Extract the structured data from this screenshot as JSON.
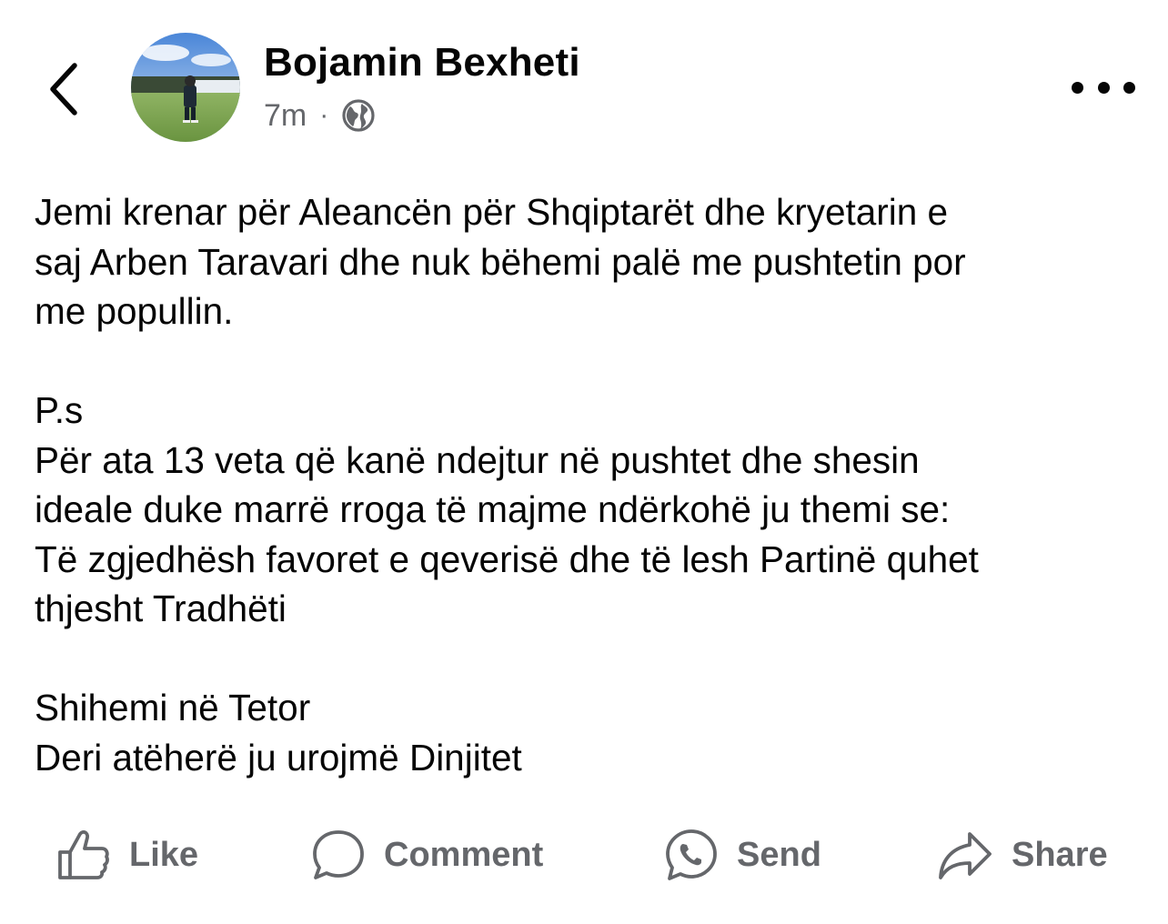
{
  "post": {
    "author": "Bojamin Bexheti",
    "timestamp": "7m",
    "separator": "·",
    "audience_icon": "globe-icon",
    "paragraphs": [
      [
        "Jemi krenar për Aleancën për Shqiptarët dhe kryetarin e",
        "saj Arben Taravari dhe nuk bëhemi palë me pushtetin por",
        "me popullin."
      ],
      [
        "P.s",
        "Për ata 13 veta që kanë ndejtur në pushtet dhe shesin",
        "ideale duke marrë rroga të majme ndërkohë ju themi se:",
        "Të zgjedhësh favoret e qeverisë dhe të lesh Partinë quhet",
        "thjesht Tradhëti"
      ],
      [
        "Shihemi në Tetor",
        "Deri atëherë ju urojmë Dinjitet"
      ]
    ]
  },
  "actions": {
    "like": "Like",
    "comment": "Comment",
    "send": "Send",
    "share": "Share"
  },
  "icons": {
    "back": "chevron-left-icon",
    "more": "more-options-icon",
    "like": "thumbs-up-icon",
    "comment": "comment-bubble-icon",
    "send": "messenger-icon",
    "share": "share-arrow-icon"
  },
  "colors": {
    "text": "#050505",
    "secondary_text": "#65676b",
    "background": "#ffffff"
  }
}
